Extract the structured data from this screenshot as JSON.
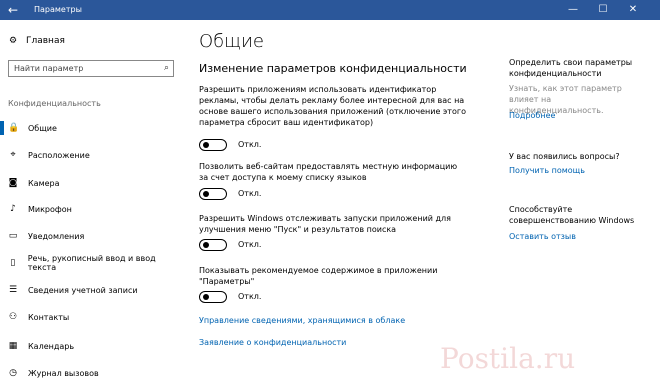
{
  "window": {
    "title": "Параметры",
    "back_icon": "arrow-left-icon",
    "controls": [
      "—",
      "☐",
      "✕"
    ],
    "titlebar_color": "#2b579a"
  },
  "sidebar": {
    "home_label": "Главная",
    "search_placeholder": "Найти параметр",
    "section_label": "Конфиденциальность",
    "items": [
      {
        "label": "Общие",
        "icon": "lock-icon",
        "selected": true
      },
      {
        "label": "Расположение",
        "icon": "location-icon"
      },
      {
        "label": "Камера",
        "icon": "camera-icon"
      },
      {
        "label": "Микрофон",
        "icon": "microphone-icon"
      },
      {
        "label": "Уведомления",
        "icon": "notifications-icon"
      },
      {
        "label": "Речь, рукописный ввод и ввод текста",
        "icon": "speech-icon"
      },
      {
        "label": "Сведения учетной записи",
        "icon": "account-info-icon"
      },
      {
        "label": "Контакты",
        "icon": "contacts-icon"
      },
      {
        "label": "Календарь",
        "icon": "calendar-icon"
      },
      {
        "label": "Журнал вызовов",
        "icon": "call-history-icon"
      }
    ]
  },
  "main": {
    "page_title": "Общие",
    "section_heading": "Изменение параметров конфиденциальности",
    "settings": [
      {
        "text": "Разрешить приложениям использовать идентификатор рекламы, чтобы делать рекламу более интересной для вас на основе вашего использования приложений (отключение этого параметра сбросит ваш идентификатор)",
        "state": "Откл."
      },
      {
        "text": "Позволить веб-сайтам предоставлять местную информацию за счет доступа к моему списку языков",
        "state": "Откл."
      },
      {
        "text": "Разрешить Windows отслеживать запуски приложений для улучшения меню \"Пуск\" и результатов поиска",
        "state": "Откл."
      },
      {
        "text": "Показывать рекомендуемое содержимое в приложении \"Параметры\"",
        "state": "Откл."
      }
    ],
    "link_manage_cloud": "Управление сведениями, хранящимися в облаке",
    "link_privacy_statement": "Заявление о конфиденциальности"
  },
  "right_panel": {
    "block1_heading": "Определить свои параметры конфиденциальности",
    "block1_text": "Узнать, как этот параметр влияет на конфиденциальность.",
    "block1_link": "Подробнее",
    "block2_heading": "У вас появились вопросы?",
    "block2_link": "Получить помощь",
    "block3_heading": "Способствуйте совершенствованию Windows",
    "block3_link": "Оставить отзыв",
    "link_color": "#0063b1"
  },
  "watermark_text": "Postila.ru"
}
